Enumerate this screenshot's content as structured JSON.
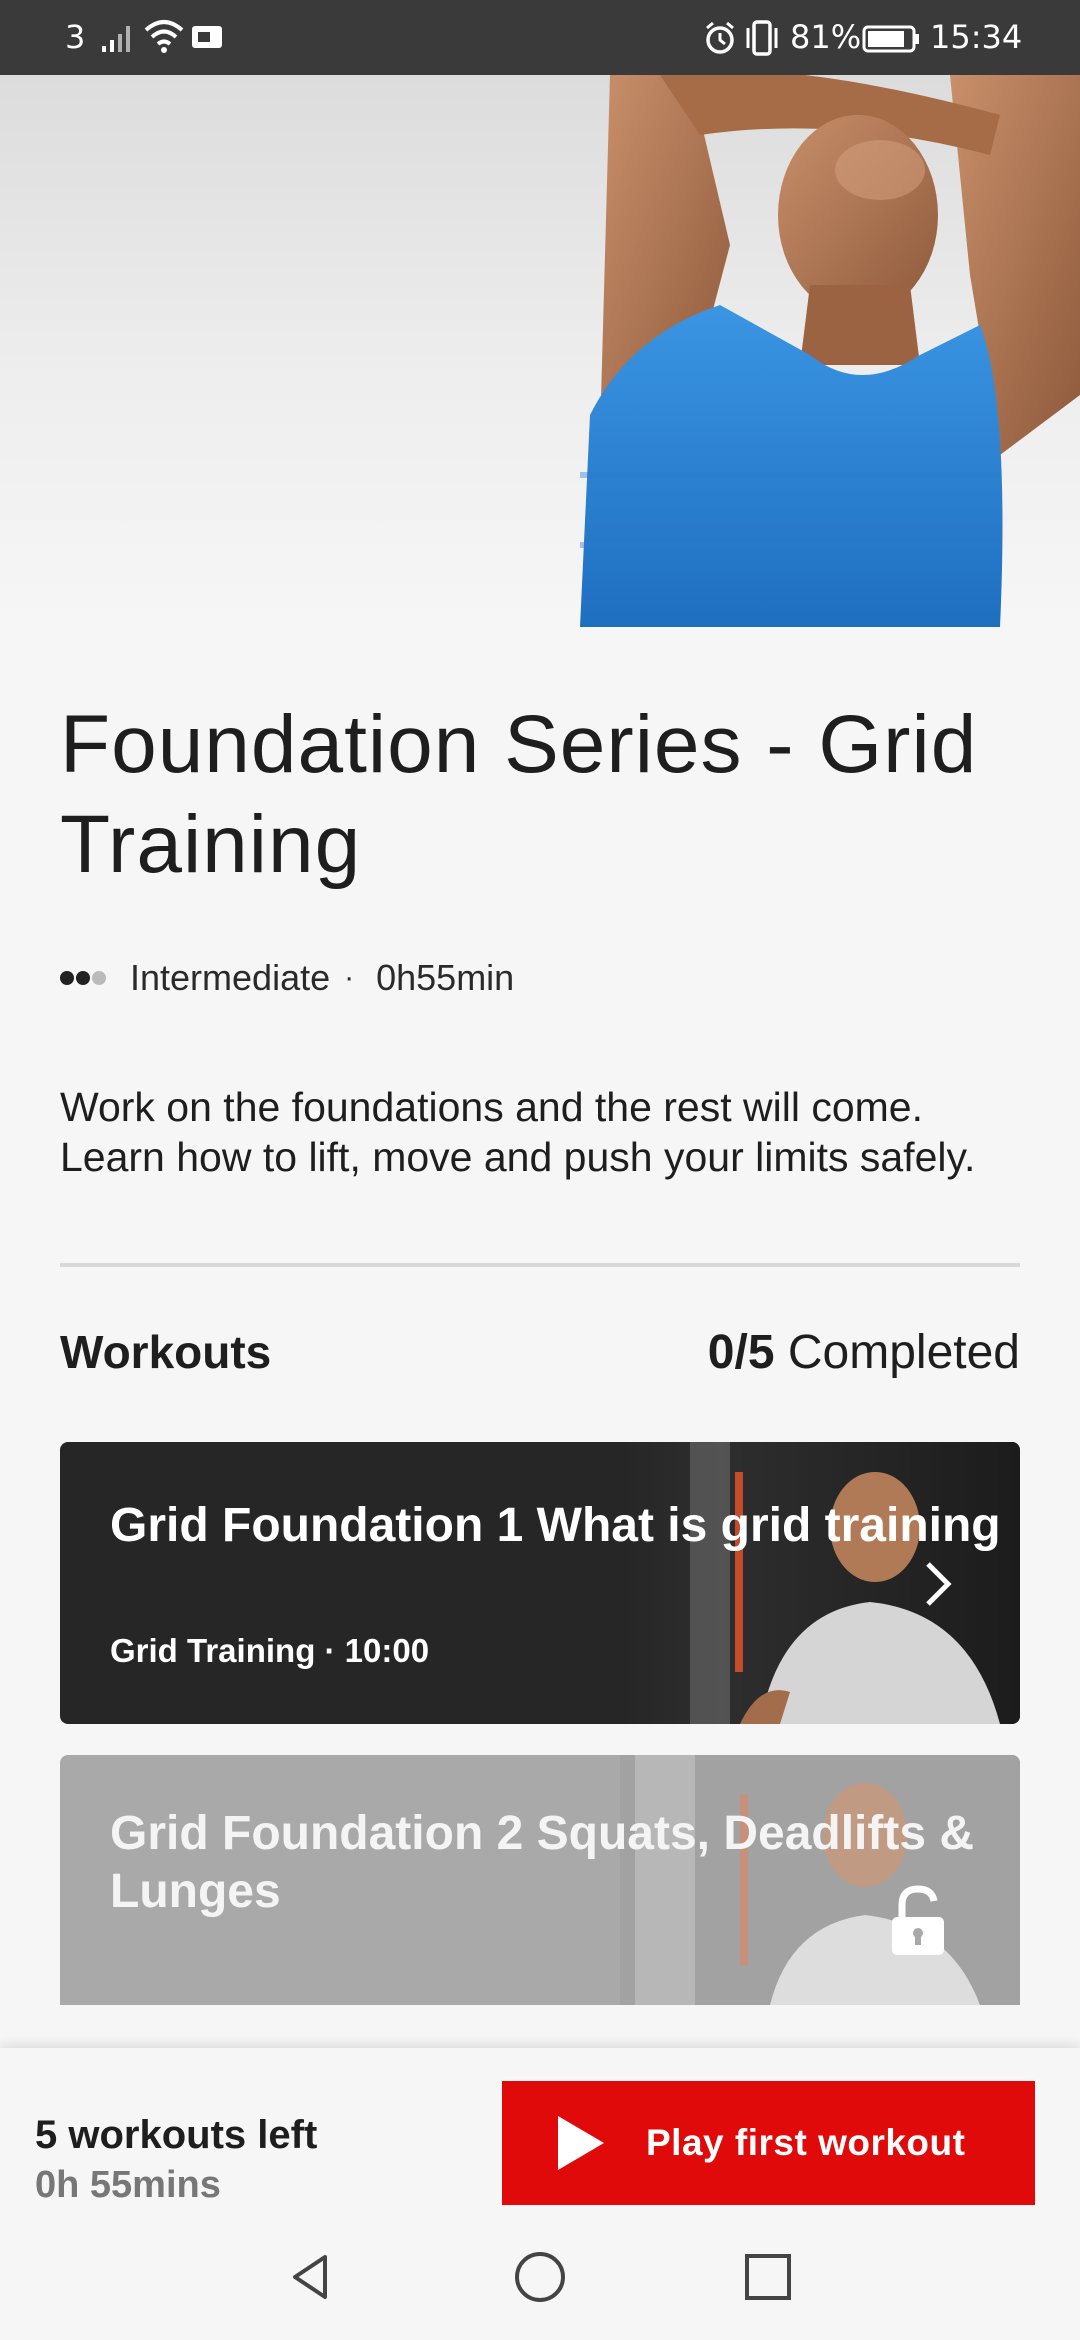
{
  "status_bar": {
    "carrier": "3",
    "battery": "81%",
    "time": "15:34"
  },
  "program": {
    "title": "Foundation Series - Grid Training",
    "level": "Intermediate",
    "duration": "0h55min",
    "description": "Work on the foundations and the rest will come. Learn how to lift, move and push your limits safely."
  },
  "workouts": {
    "header": "Workouts",
    "completed_count": "0/5",
    "completed_label": "Completed",
    "items": [
      {
        "title": "Grid Foundation 1 What is grid training",
        "subtitle": "Grid Training · 10:00",
        "locked": false
      },
      {
        "title": "Grid Foundation 2 Squats, Deadlifts & Lunges",
        "locked": true
      }
    ]
  },
  "footer": {
    "workouts_left": "5 workouts left",
    "time_left": "0h 55mins",
    "play_label": "Play first workout"
  },
  "colors": {
    "accent": "#e10a0a",
    "card_dark": "#262626",
    "card_locked": "#a9a9a9",
    "shirt": "#2f86d6"
  },
  "icons": {
    "signal": "signal-icon",
    "wifi": "wifi-icon",
    "alarm": "alarm-icon",
    "vibrate": "vibrate-icon",
    "battery": "battery-icon",
    "chevron": "chevron-right-icon",
    "lock": "lock-icon",
    "play": "play-icon",
    "nav_back": "back-icon",
    "nav_home": "home-icon",
    "nav_recents": "recents-icon"
  }
}
